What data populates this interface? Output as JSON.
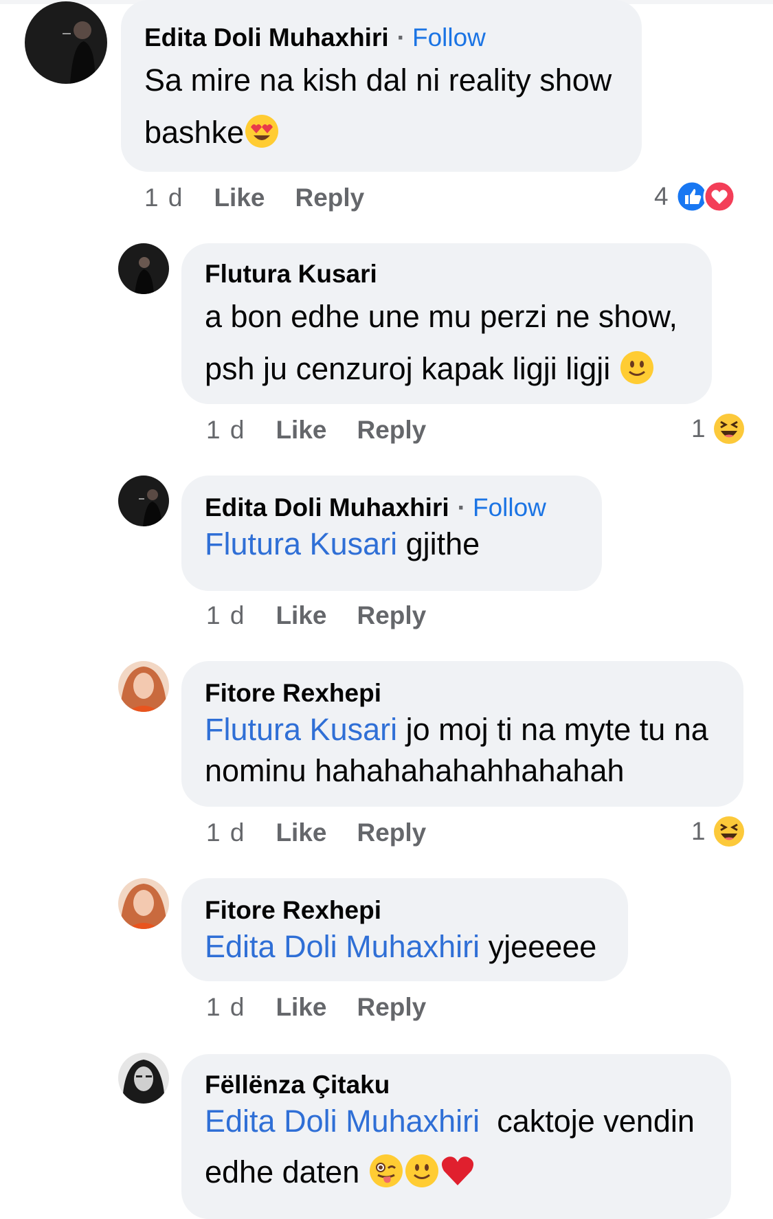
{
  "comments": [
    {
      "author": "Edita Doli Muhaxhiri",
      "follow": "Follow",
      "line1": "Sa mire na kish dal ni reality show",
      "line2": "bashke",
      "time": "1 d",
      "like": "Like",
      "reply": "Reply",
      "reaction_count": "4",
      "reactions": [
        "like-reaction-icon",
        "love-reaction-icon"
      ]
    },
    {
      "author": "Flutura Kusari",
      "line1": "a bon edhe une mu perzi ne show,",
      "line2": "psh ju cenzuroj kapak ligji ligji",
      "time": "1 d",
      "like": "Like",
      "reply": "Reply",
      "reaction_count": "1",
      "reactions": [
        "haha-reaction-icon"
      ]
    },
    {
      "author": "Edita Doli Muhaxhiri",
      "follow": "Follow",
      "mention": "Flutura Kusari",
      "text": "gjithe",
      "time": "1 d",
      "like": "Like",
      "reply": "Reply"
    },
    {
      "author": "Fitore Rexhepi",
      "mention": "Flutura Kusari",
      "line1": "jo moj ti na myte tu na",
      "line2": "nominu hahahahahahhahahah",
      "time": "1 d",
      "like": "Like",
      "reply": "Reply",
      "reaction_count": "1",
      "reactions": [
        "haha-reaction-icon"
      ]
    },
    {
      "author": "Fitore Rexhepi",
      "mention": "Edita Doli Muhaxhiri",
      "text": "yjeeeee",
      "time": "1 d",
      "like": "Like",
      "reply": "Reply"
    },
    {
      "author": "Fëllënza Çitaku",
      "mention": "Edita Doli Muhaxhiri",
      "line1": "caktoje vendin",
      "line2": "edhe daten"
    }
  ],
  "colors": {
    "bubble": "#f0f2f5",
    "link": "#1b74e4",
    "meta": "#65676b",
    "like_blue": "#1877f2",
    "love_red": "#f33e58"
  }
}
